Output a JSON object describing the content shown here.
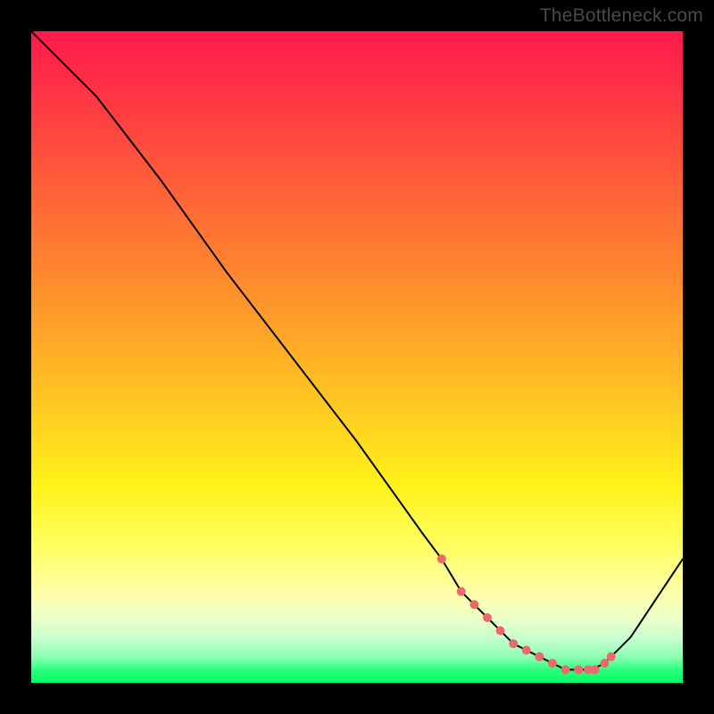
{
  "attribution": "TheBottleneck.com",
  "chart_data": {
    "type": "line",
    "title": "",
    "xlabel": "",
    "ylabel": "",
    "xlim": [
      0,
      100
    ],
    "ylim": [
      0,
      100
    ],
    "grid": false,
    "legend": false,
    "series": [
      {
        "name": "curve",
        "color": "#000000",
        "x": [
          0,
          6,
          10,
          20,
          30,
          40,
          50,
          60,
          63,
          66,
          68,
          70,
          72,
          74,
          76,
          78,
          80,
          82,
          84,
          86,
          88,
          92,
          96,
          100
        ],
        "values": [
          100,
          94,
          90,
          77,
          63,
          50,
          37,
          23,
          19,
          14,
          12,
          10,
          8,
          6,
          5,
          4,
          3,
          2,
          2,
          2,
          3,
          7,
          13,
          19
        ]
      }
    ],
    "markers": {
      "name": "dots",
      "color": "#ed6a6a",
      "radius": 5,
      "x": [
        63,
        66,
        68,
        70,
        72,
        74,
        76,
        78,
        80,
        82,
        84,
        85.5,
        86.5,
        88,
        89
      ],
      "values": [
        19,
        14,
        12,
        10,
        8,
        6,
        5,
        4,
        3,
        2,
        2,
        2,
        2,
        3,
        4
      ]
    },
    "gradient_stops": [
      {
        "pos": 0,
        "color": "#ff1a4b"
      },
      {
        "pos": 8,
        "color": "#ff2f45"
      },
      {
        "pos": 22,
        "color": "#ff5a3a"
      },
      {
        "pos": 38,
        "color": "#ff8a2e"
      },
      {
        "pos": 55,
        "color": "#ffc023"
      },
      {
        "pos": 70,
        "color": "#fff31a"
      },
      {
        "pos": 80,
        "color": "#ffff6a"
      },
      {
        "pos": 86,
        "color": "#ffffa7"
      },
      {
        "pos": 90,
        "color": "#eeffc7"
      },
      {
        "pos": 93,
        "color": "#c9ffcf"
      },
      {
        "pos": 96,
        "color": "#8fffb6"
      },
      {
        "pos": 98,
        "color": "#2bff7d"
      },
      {
        "pos": 100,
        "color": "#00ff64"
      }
    ]
  }
}
